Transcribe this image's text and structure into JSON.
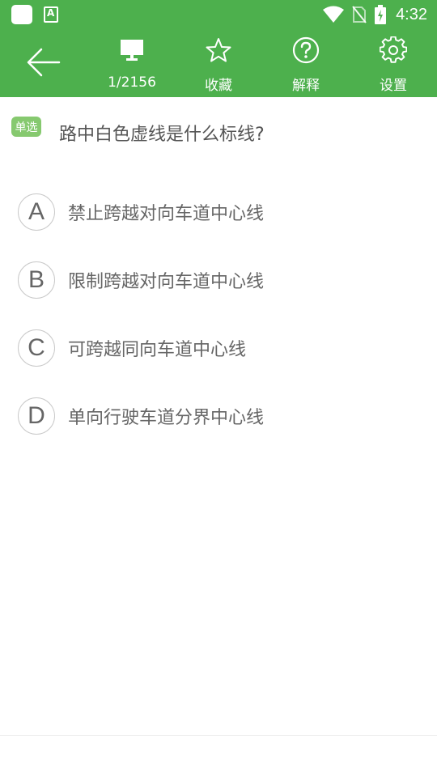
{
  "status_bar": {
    "time": "4:32",
    "icons": [
      "notification-square-icon",
      "app-a-icon",
      "wifi-icon",
      "no-sim-icon",
      "battery-charging-icon"
    ]
  },
  "toolbar": {
    "back_icon": "arrow-left-icon",
    "items": [
      {
        "icon": "monitor-icon",
        "label": "1/2156"
      },
      {
        "icon": "star-icon",
        "label": "收藏"
      },
      {
        "icon": "question-circle-icon",
        "label": "解释"
      },
      {
        "icon": "gear-icon",
        "label": "设置"
      }
    ],
    "color": "#4db04d"
  },
  "question": {
    "type_badge": "单选",
    "text": "路中白色虚线是什么标线?"
  },
  "options": [
    {
      "letter": "A",
      "text": "禁止跨越对向车道中心线"
    },
    {
      "letter": "B",
      "text": "限制跨越对向车道中心线"
    },
    {
      "letter": "C",
      "text": "可跨越同向车道中心线"
    },
    {
      "letter": "D",
      "text": "单向行驶车道分界中心线"
    }
  ]
}
